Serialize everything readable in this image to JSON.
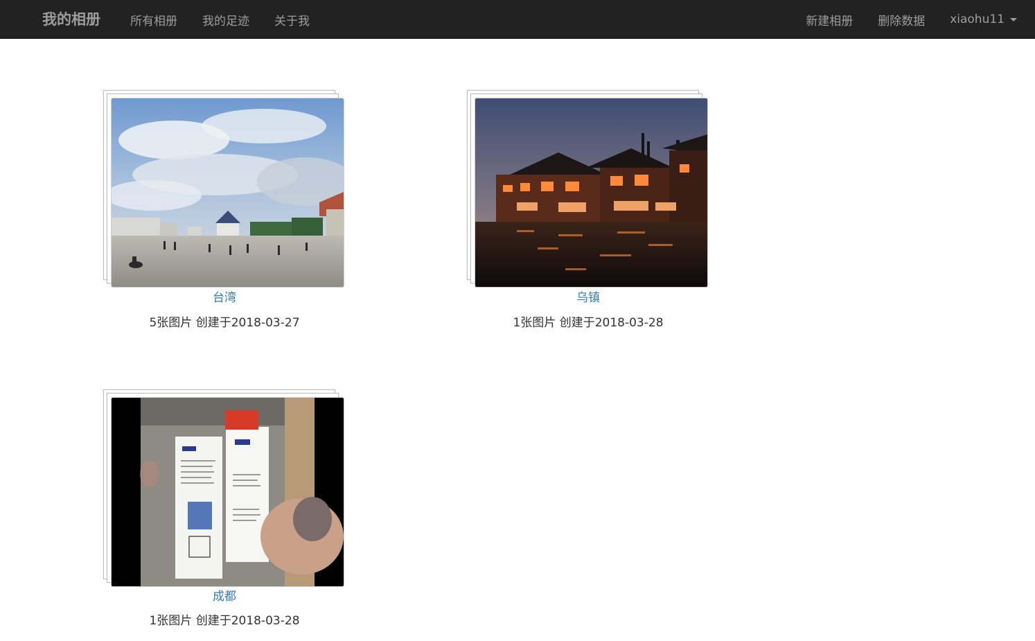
{
  "nav": {
    "brand": "我的相册",
    "links": [
      "所有相册",
      "我的足迹",
      "关于我"
    ],
    "right_links": [
      "新建相册",
      "删除数据"
    ],
    "user": "xiaohu11"
  },
  "albums": [
    {
      "name": "台湾",
      "count": "5张图片",
      "created": "创建于2018-03-27",
      "cover": "plaza-under-cloudy-sky"
    },
    {
      "name": "乌镇",
      "count": "1张图片",
      "created": "创建于2018-03-28",
      "cover": "water-town-night"
    },
    {
      "name": "成都",
      "count": "1张图片",
      "created": "创建于2018-03-28",
      "cover": "store-price-tags"
    }
  ],
  "colors": {
    "navbar_bg": "#222222",
    "nav_text": "#9d9d9d",
    "link": "#337ab7",
    "text": "#333333"
  }
}
